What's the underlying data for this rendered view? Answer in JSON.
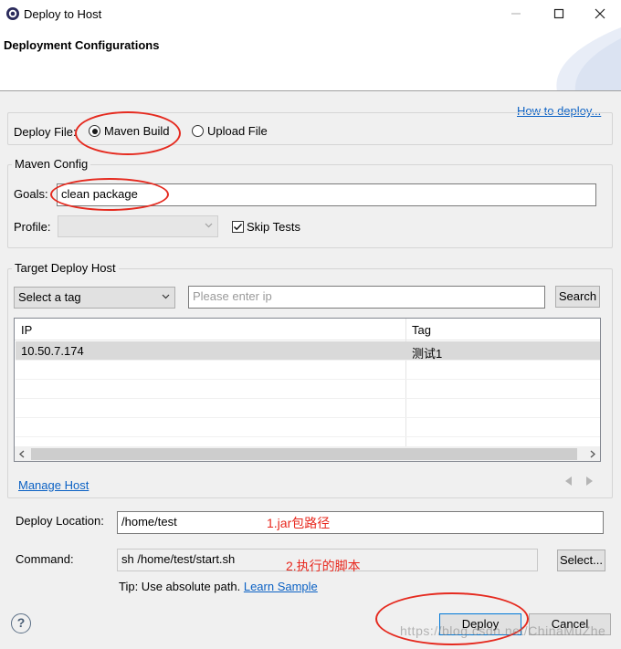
{
  "window": {
    "title": "Deploy to Host",
    "header_title": "Deployment Configurations",
    "help_link": "How to deploy..."
  },
  "deploy_file": {
    "label": "Deploy File:",
    "options": [
      "Maven Build",
      "Upload File"
    ],
    "selected": "Maven Build"
  },
  "maven_config": {
    "legend": "Maven Config",
    "goals_label": "Goals:",
    "goals_value": "clean package",
    "profile_label": "Profile:",
    "profile_value": "",
    "skip_tests_label": "Skip Tests",
    "skip_tests_checked": true
  },
  "target": {
    "legend": "Target Deploy Host",
    "tag_select": "Select a tag",
    "ip_placeholder": "Please enter ip",
    "search_label": "Search",
    "columns": [
      "IP",
      "Tag"
    ],
    "rows": [
      {
        "ip": "10.50.7.174",
        "tag": "测试1"
      }
    ],
    "manage_host": "Manage Host"
  },
  "deploy_location": {
    "label": "Deploy Location:",
    "value": "/home/test",
    "annotation": "1.jar包路径"
  },
  "command": {
    "label": "Command:",
    "value": "sh /home/test/start.sh",
    "annotation": "2.执行的脚本",
    "select_label": "Select...",
    "tip_prefix": "Tip: Use absolute path.",
    "tip_link": "Learn Sample"
  },
  "footer": {
    "help": "?",
    "deploy_label": "Deploy",
    "cancel_label": "Cancel",
    "watermark": "https://blog.csdn.net/ChinaMuZhe"
  }
}
